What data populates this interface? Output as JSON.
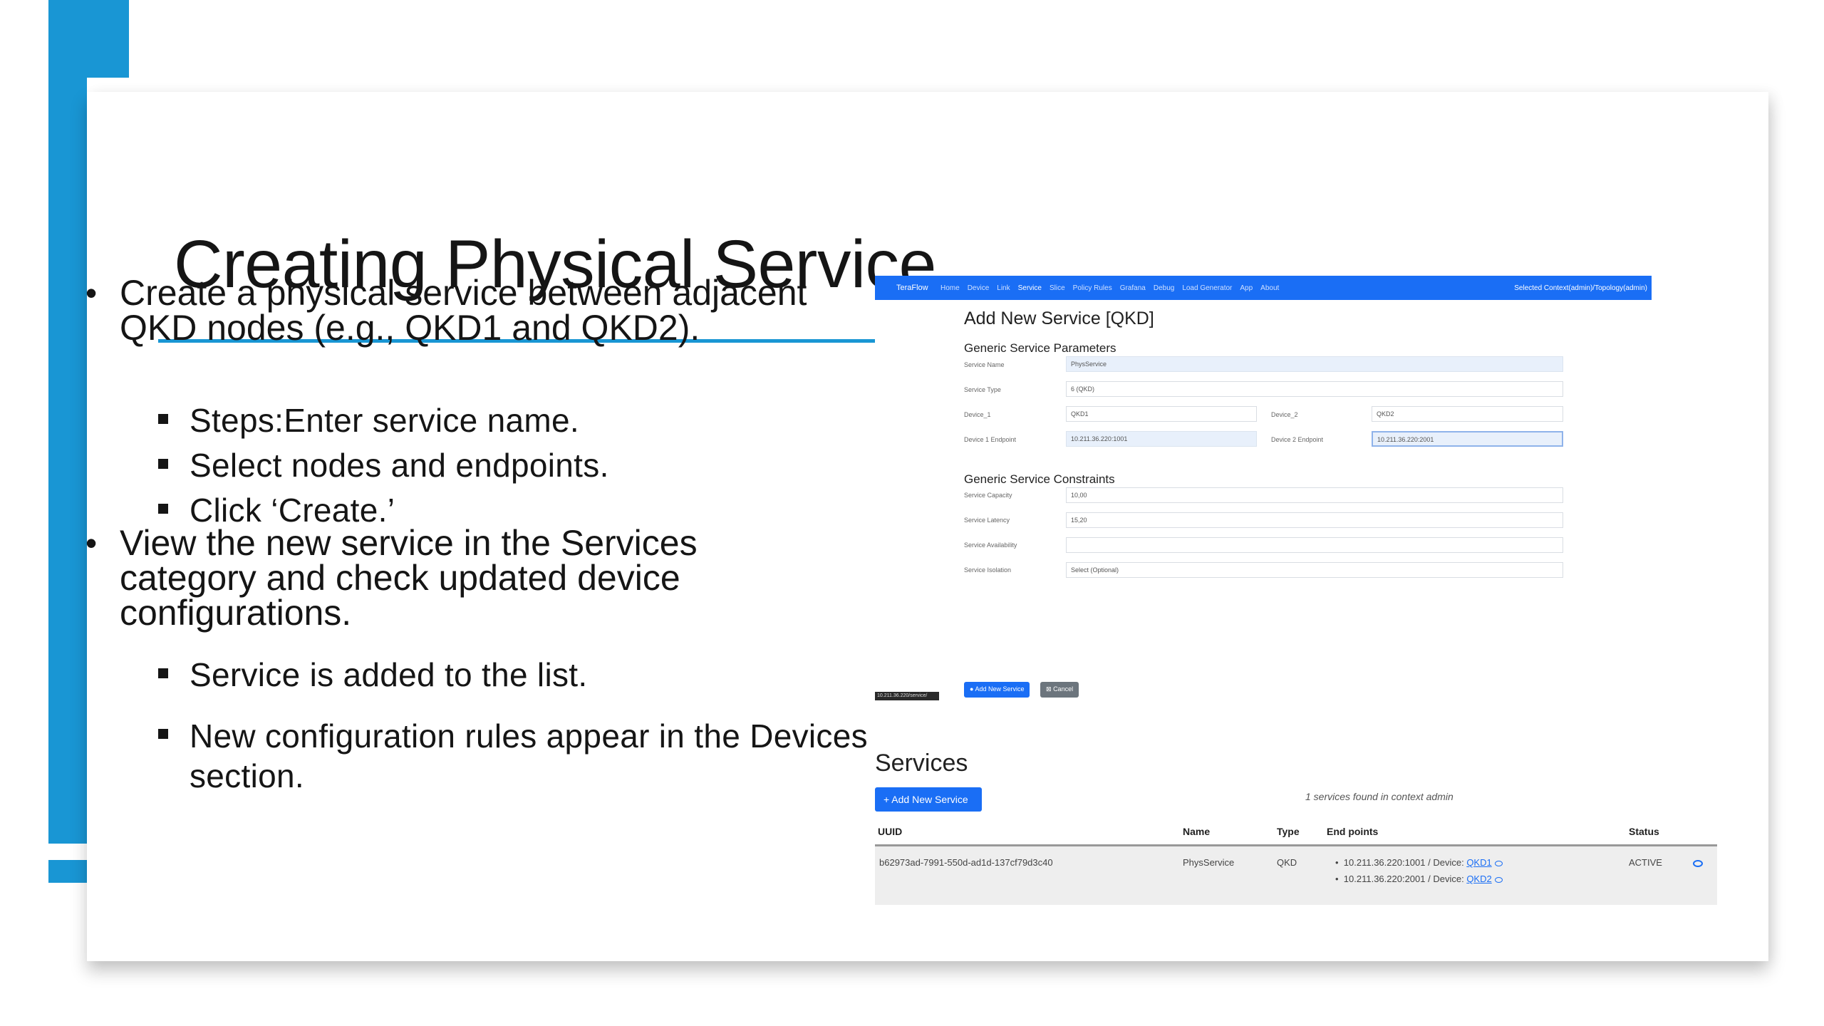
{
  "slide": {
    "title": "Creating Physical Service",
    "bullets": [
      {
        "text": "Create a physical service between adjacent QKD nodes (e.g., QKD1 and QKD2)."
      },
      {
        "text": "View the new service in the Services category and check updated device configurations."
      }
    ],
    "sub_bullets": [
      "Steps:Enter service name.",
      "Select nodes and endpoints.",
      "Click ‘Create.’",
      "Service is added to the list.",
      "New configuration rules appear in the Devices section."
    ]
  },
  "add_service_screen": {
    "nav": {
      "brand": "TeraFlow",
      "links": [
        "Home",
        "Device",
        "Link",
        "Service",
        "Slice",
        "Policy Rules",
        "Grafana",
        "Debug",
        "Load Generator",
        "App",
        "About"
      ],
      "context": "Selected Context(admin)/Topology(admin)"
    },
    "title": "Add New Service [QKD]",
    "params_heading": "Generic Service Parameters",
    "service_name_label": "Service Name",
    "service_name_value": "PhysService",
    "service_type_label": "Service Type",
    "service_type_value": "6 (QKD)",
    "device1_label": "Device_1",
    "device1_value": "QKD1",
    "device2_label": "Device_2",
    "device2_value": "QKD2",
    "device1_endpoint_label": "Device 1 Endpoint",
    "device1_endpoint_value": "10.211.36.220:1001",
    "device2_endpoint_label": "Device 2 Endpoint",
    "device2_endpoint_value": "10.211.36.220:2001",
    "constraints_heading": "Generic Service Constraints",
    "capacity_label": "Service Capacity",
    "capacity_value": "10,00",
    "latency_label": "Service Latency",
    "latency_value": "15,20",
    "availability_label": "Service Availability",
    "availability_value": "",
    "isolation_label": "Service Isolation",
    "isolation_value": "Select (Optional)",
    "add_button": "Add New Service",
    "cancel_button": "Cancel",
    "url_chip": "10.211.36.220/service/"
  },
  "services_screen": {
    "title": "Services",
    "add_button": "+ Add New Service",
    "count_text": "1 services found in context admin",
    "columns": [
      "UUID",
      "Name",
      "Type",
      "End points",
      "Status"
    ],
    "row": {
      "uuid": "b62973ad-7991-550d-ad1d-137cf79d3c40",
      "name": "PhysService",
      "type": "QKD",
      "endpoint1_addr": "10.211.36.220:1001 / Device:",
      "endpoint1_device": "QKD1",
      "endpoint2_addr": "10.211.36.220:2001 / Device:",
      "endpoint2_device": "QKD2",
      "status": "ACTIVE"
    }
  },
  "colors": {
    "accent": "#1996d4",
    "nav_blue": "#1a6ef5"
  }
}
